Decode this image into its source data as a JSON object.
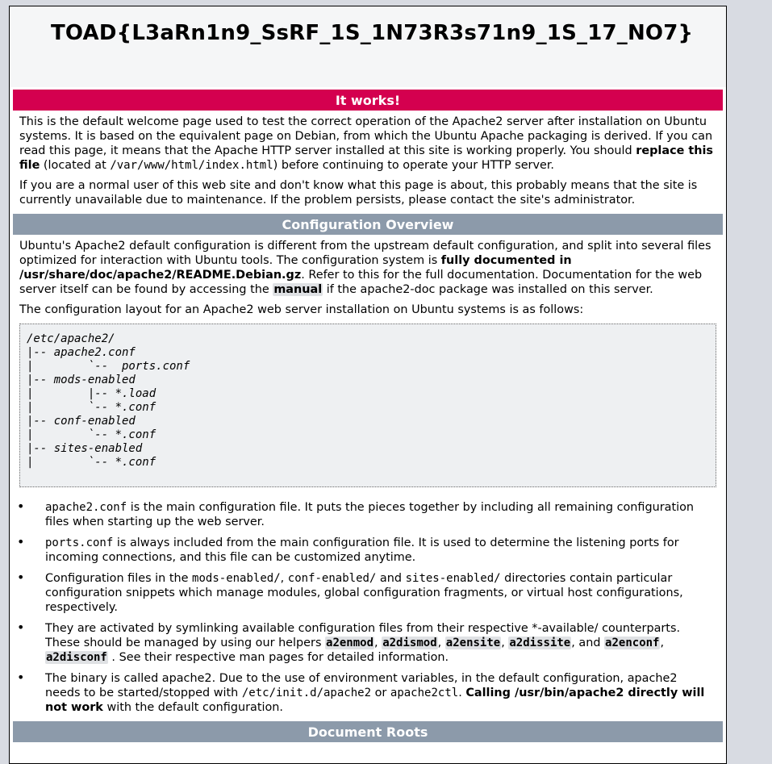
{
  "flag": "TOAD{L3aRn1n9_SsRF_1S_1N73R3s71n9_1S_17_NO7}",
  "sections": {
    "it_works": "It works!",
    "config_overview": "Configuration Overview",
    "document_roots": "Document Roots"
  },
  "intro": {
    "p1_a": "This is the default welcome page used to test the correct operation of the Apache2 server after installation on Ubuntu systems. It is based on the equivalent page on Debian, from which the Ubuntu Apache packaging is derived. If you can read this page, it means that the Apache HTTP server installed at this site is working properly. You should ",
    "p1_bold": "replace this file",
    "p1_b": " (located at ",
    "p1_code": "/var/www/html/index.html",
    "p1_c": ") before continuing to operate your HTTP server.",
    "p2": "If you are a normal user of this web site and don't know what this page is about, this probably means that the site is currently unavailable due to maintenance. If the problem persists, please contact the site's administrator."
  },
  "config": {
    "p1_a": "Ubuntu's Apache2 default configuration is different from the upstream default configuration, and split into several files optimized for interaction with Ubuntu tools. The configuration system is ",
    "p1_bold": "fully documented in /usr/share/doc/apache2/README.Debian.gz",
    "p1_b": ". Refer to this for the full documentation. Documentation for the web server itself can be found by accessing the ",
    "p1_manual": "manual",
    "p1_c": " if the apache2-doc package was installed on this server.",
    "p2": "The configuration layout for an Apache2 web server installation on Ubuntu systems is as follows:",
    "tree": "/etc/apache2/\n|-- apache2.conf\n|        `--  ports.conf\n|-- mods-enabled\n|        |-- *.load\n|        `-- *.conf\n|-- conf-enabled\n|        `-- *.conf\n|-- sites-enabled\n|        `-- *.conf"
  },
  "bullets": {
    "b1_code": "apache2.conf",
    "b1_text": " is the main configuration file. It puts the pieces together by including all remaining configuration files when starting up the web server.",
    "b2_code": "ports.conf",
    "b2_text": " is always included from the main configuration file. It is used to determine the listening ports for incoming connections, and this file can be customized anytime.",
    "b3_a": "Configuration files in the ",
    "b3_code1": "mods-enabled/",
    "b3_sep": ", ",
    "b3_code2": "conf-enabled/",
    "b3_and": " and ",
    "b3_code3": "sites-enabled/",
    "b3_b": " directories contain particular configuration snippets which manage modules, global configuration fragments, or virtual host configurations, respectively.",
    "b4_a": "They are activated by symlinking available configuration files from their respective *-available/ counterparts. These should be managed by using our helpers ",
    "b4_h1": "a2enmod",
    "b4_h2": "a2dismod",
    "b4_h3": "a2ensite",
    "b4_h4": "a2dissite",
    "b4_and": ", and ",
    "b4_h5": "a2enconf",
    "b4_h6": "a2disconf",
    "b4_b": " . See their respective man pages for detailed information.",
    "b5_a": "The binary is called apache2. Due to the use of environment variables, in the default configuration, apache2 needs to be started/stopped with ",
    "b5_code1": "/etc/init.d/apache2",
    "b5_or": " or ",
    "b5_code2": "apache2ctl",
    "b5_dot": ". ",
    "b5_bold": "Calling /usr/bin/apache2 directly will not work",
    "b5_b": " with the default configuration."
  },
  "bullet_glyph": "•"
}
